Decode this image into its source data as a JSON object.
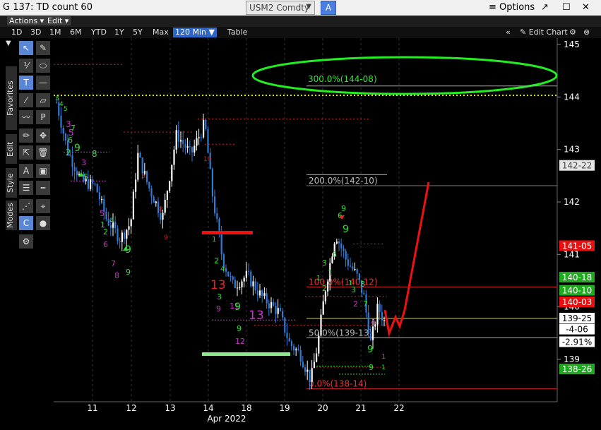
{
  "window": {
    "title": "G 137: TD count 60",
    "ticker": "USM2 Comdty",
    "ticker_button": "A",
    "options_label": "Options"
  },
  "menus": {
    "actions": "Actions",
    "edit": "Edit"
  },
  "periods": [
    "1D",
    "3D",
    "1M",
    "6M",
    "YTD",
    "1Y",
    "5Y",
    "Max"
  ],
  "interval": "120 Min",
  "table_label": "Table",
  "edit_chart_label": "Edit Chart",
  "side_tabs": [
    "Favorites",
    "Edit",
    "Style",
    "Modes"
  ],
  "colors": {
    "up": "#ffffff",
    "down": "#2f7bd6",
    "setup_green": "#33dd33",
    "setup_magenta": "#cc33cc",
    "forecast": "#ee1111",
    "ellipse": "#22ee22"
  },
  "chart_data": {
    "type": "candlestick",
    "x_ticks": [
      "11",
      "12",
      "13",
      "14",
      "18",
      "19",
      "20",
      "21",
      "22"
    ],
    "x_group_label": "Apr 2022",
    "y_ticks": [
      "145",
      "144",
      "143",
      "142",
      "141",
      "140",
      "139",
      "138"
    ],
    "ylim": [
      137.5,
      145.1
    ],
    "price_labels": [
      {
        "text": "142-22",
        "value": 142.69,
        "bg": "#e6e6e6",
        "fg": "#444"
      },
      {
        "text": "141-05",
        "value": 141.16,
        "bg": "#e81010",
        "fg": "#fff"
      },
      {
        "text": "140-18",
        "value": 140.56,
        "bg": "#1faa1f",
        "fg": "#fff"
      },
      {
        "text": "140-10",
        "value": 140.31,
        "bg": "#1faa1f",
        "fg": "#fff"
      },
      {
        "text": "140-03",
        "value": 140.09,
        "bg": "#e81010",
        "fg": "#fff"
      },
      {
        "text": "139-25",
        "value": 139.78,
        "bg": "#ffffff",
        "fg": "#000"
      },
      {
        "text": "-4-06",
        "value": 139.57,
        "bg": "#ffffff",
        "fg": "#000"
      },
      {
        "text": "-2.91%",
        "value": 139.33,
        "bg": "#ffffff",
        "fg": "#000"
      },
      {
        "text": "138-26",
        "value": 138.81,
        "bg": "#1faa1f",
        "fg": "#fff"
      }
    ],
    "fib_levels": [
      {
        "text": "300.0%(144-08)",
        "value": 144.25
      },
      {
        "text": "200.0%(142-10)",
        "value": 142.31
      },
      {
        "text": "100.0%(140-12)",
        "value": 140.38
      },
      {
        "text": "50.0%(139-13)",
        "value": 139.41
      },
      {
        "text": "0.0%(138-14)",
        "value": 138.44
      }
    ],
    "td_labels": [
      "13",
      "13"
    ]
  }
}
